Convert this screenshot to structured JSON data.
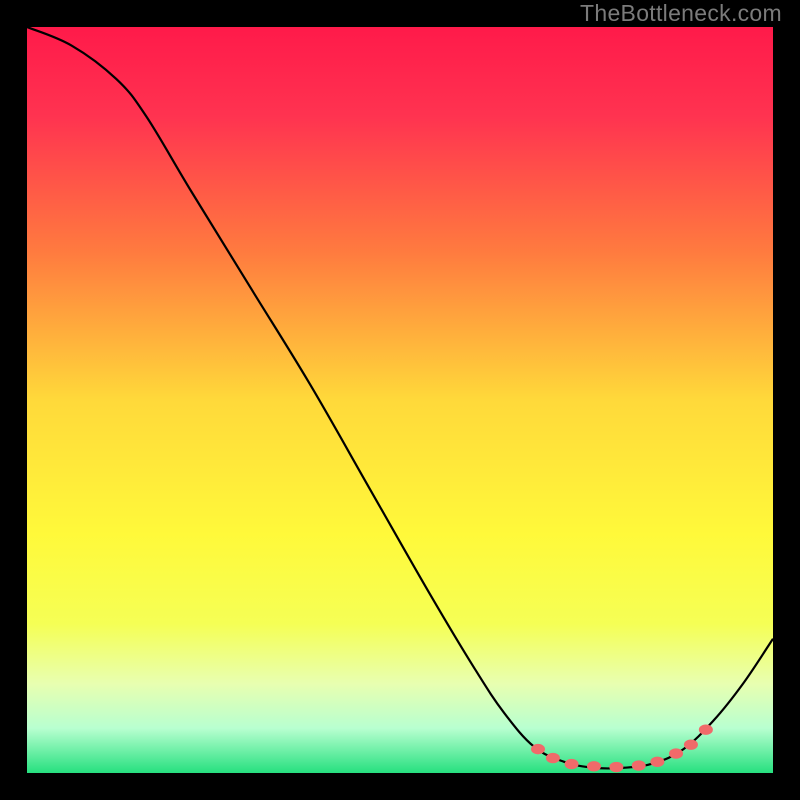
{
  "watermark": "TheBottleneck.com",
  "chart_data": {
    "type": "line",
    "title": "",
    "xlabel": "",
    "ylabel": "",
    "xlim": [
      0,
      100
    ],
    "ylim": [
      0,
      100
    ],
    "background_gradient": {
      "stops": [
        {
          "offset": 0,
          "color": "#ff1a4a"
        },
        {
          "offset": 12,
          "color": "#ff3350"
        },
        {
          "offset": 30,
          "color": "#ff7a3f"
        },
        {
          "offset": 50,
          "color": "#ffd93a"
        },
        {
          "offset": 68,
          "color": "#fff93a"
        },
        {
          "offset": 80,
          "color": "#f5ff55"
        },
        {
          "offset": 88,
          "color": "#e8ffb0"
        },
        {
          "offset": 94,
          "color": "#b8ffd0"
        },
        {
          "offset": 100,
          "color": "#26e07f"
        }
      ]
    },
    "curve": [
      {
        "x": 0,
        "y": 100
      },
      {
        "x": 6,
        "y": 97.5
      },
      {
        "x": 12,
        "y": 93
      },
      {
        "x": 16,
        "y": 88
      },
      {
        "x": 22,
        "y": 78
      },
      {
        "x": 30,
        "y": 65
      },
      {
        "x": 38,
        "y": 52
      },
      {
        "x": 46,
        "y": 38
      },
      {
        "x": 54,
        "y": 24
      },
      {
        "x": 60,
        "y": 14
      },
      {
        "x": 64,
        "y": 8
      },
      {
        "x": 68,
        "y": 3.5
      },
      {
        "x": 72,
        "y": 1.5
      },
      {
        "x": 76,
        "y": 0.7
      },
      {
        "x": 80,
        "y": 0.7
      },
      {
        "x": 84,
        "y": 1.3
      },
      {
        "x": 88,
        "y": 3.2
      },
      {
        "x": 92,
        "y": 7
      },
      {
        "x": 96,
        "y": 12
      },
      {
        "x": 100,
        "y": 18
      }
    ],
    "markers": [
      {
        "x": 68.5,
        "y": 3.2
      },
      {
        "x": 70.5,
        "y": 2.0
      },
      {
        "x": 73.0,
        "y": 1.2
      },
      {
        "x": 76.0,
        "y": 0.9
      },
      {
        "x": 79.0,
        "y": 0.8
      },
      {
        "x": 82.0,
        "y": 1.0
      },
      {
        "x": 84.5,
        "y": 1.5
      },
      {
        "x": 87.0,
        "y": 2.6
      },
      {
        "x": 89.0,
        "y": 3.8
      },
      {
        "x": 91.0,
        "y": 5.8
      }
    ],
    "marker_color": "#f06a6a",
    "curve_color": "#000000"
  }
}
